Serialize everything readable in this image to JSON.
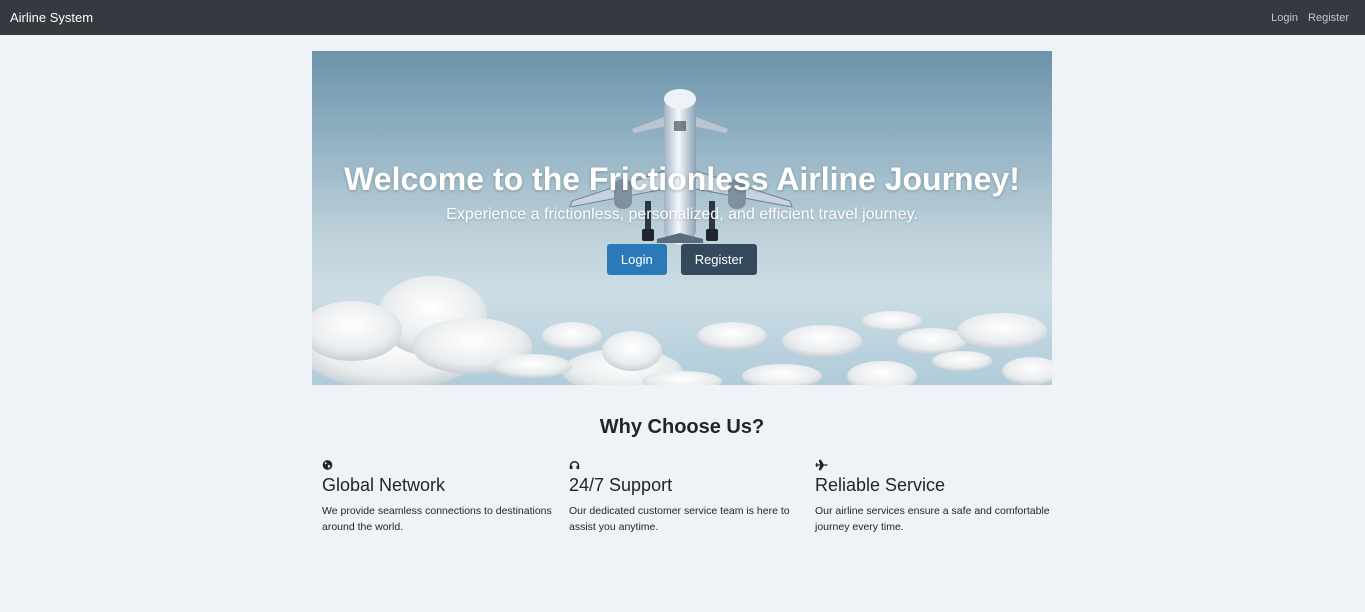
{
  "navbar": {
    "brand": "Airline System",
    "links": [
      "Login",
      "Register"
    ]
  },
  "hero": {
    "title": "Welcome to the Frictionless Airline Journey!",
    "subtitle": "Experience a frictionless, personalized, and efficient travel journey.",
    "login_label": "Login",
    "register_label": "Register"
  },
  "features": {
    "heading": "Why Choose Us?",
    "items": [
      {
        "icon": "globe-icon",
        "title": "Global Network",
        "text": "We provide seamless connections to destinations around the world."
      },
      {
        "icon": "headset-icon",
        "title": "24/7 Support",
        "text": "Our dedicated customer service team is here to assist you anytime."
      },
      {
        "icon": "plane-icon",
        "title": "Reliable Service",
        "text": "Our airline services ensure a safe and comfortable journey every time."
      }
    ]
  },
  "colors": {
    "navbar_bg": "#343a40",
    "page_bg": "#eff2f7",
    "primary_button": "#2b7ab8",
    "dark_button": "#34495e"
  }
}
